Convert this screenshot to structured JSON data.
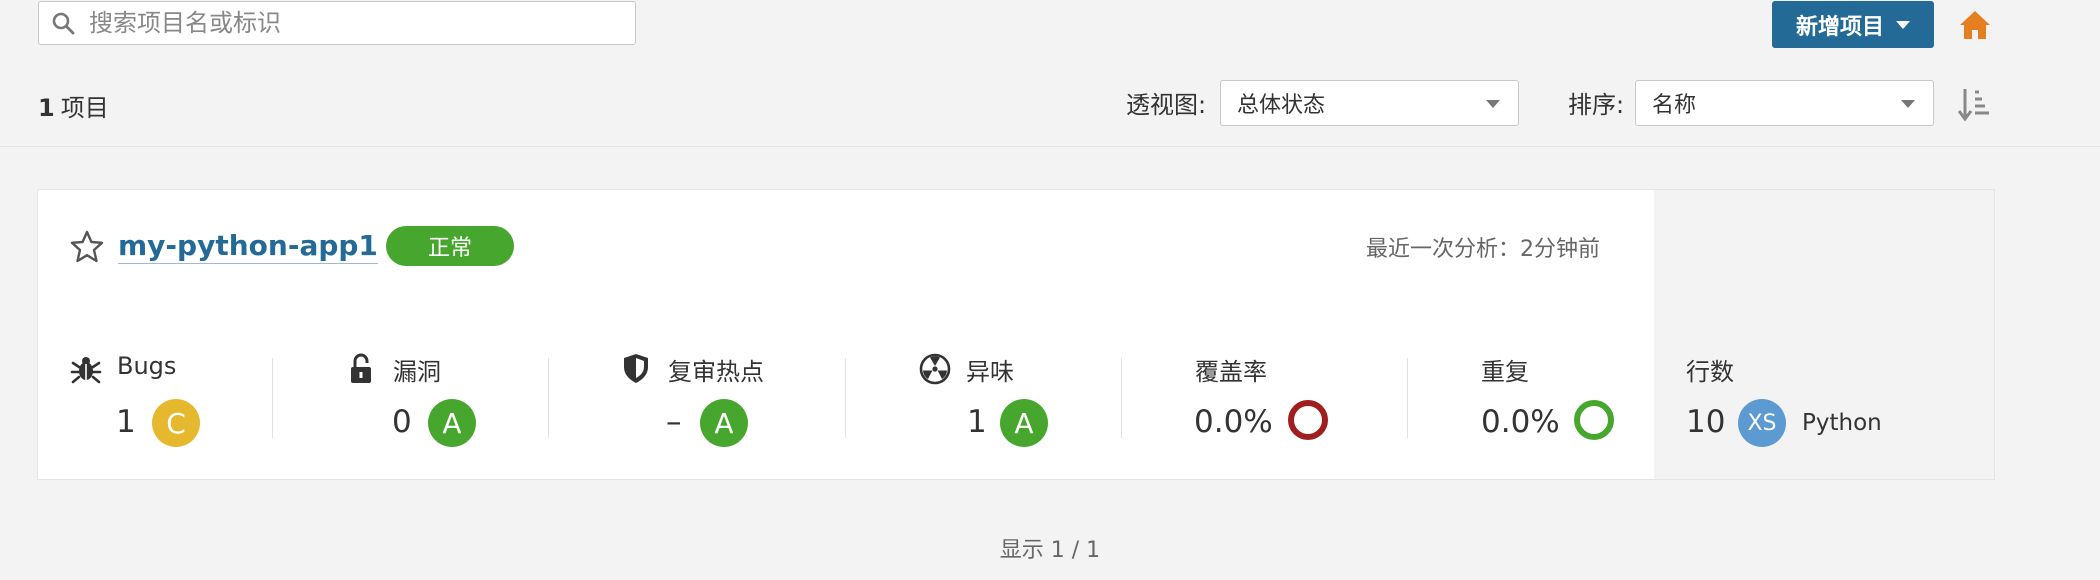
{
  "search": {
    "placeholder": "搜索项目名或标识"
  },
  "toolbar": {
    "new_project_label": "新增项目"
  },
  "summary": {
    "count": "1",
    "unit": "项目"
  },
  "perspective": {
    "label": "透视图:",
    "selected": "总体状态"
  },
  "sort": {
    "label": "排序:",
    "selected": "名称"
  },
  "project": {
    "name": "my-python-app1",
    "status": "正常",
    "last_analysis": "最近一次分析：2分钟前",
    "metrics": {
      "bugs": {
        "title": "Bugs",
        "value": "1",
        "rating": "C",
        "rating_color": "#e6b82e",
        "icon": "bug-icon"
      },
      "vulnerabilities": {
        "title": "漏洞",
        "value": "0",
        "rating": "A",
        "rating_color": "#47a62d",
        "icon": "unlock-icon"
      },
      "hotspots": {
        "title": "复审热点",
        "value": "–",
        "rating": "A",
        "rating_color": "#47a62d",
        "icon": "shield-icon"
      },
      "smells": {
        "title": "异味",
        "value": "1",
        "rating": "A",
        "rating_color": "#47a62d",
        "icon": "radiation-icon"
      },
      "coverage": {
        "title": "覆盖率",
        "value": "0.0%",
        "ring_color": "#a11e1e"
      },
      "duplication": {
        "title": "重复",
        "value": "0.0%",
        "ring_color": "#47a62d"
      },
      "lines": {
        "title": "行数",
        "value": "10",
        "size": "XS",
        "size_color": "#5c9bd1",
        "language": "Python"
      }
    }
  },
  "footer": {
    "pagination": "显示 1 / 1"
  },
  "colors": {
    "primary": "#236a97",
    "ok": "#47a62d",
    "warning": "#e6b82e",
    "home": "#e67e22"
  }
}
